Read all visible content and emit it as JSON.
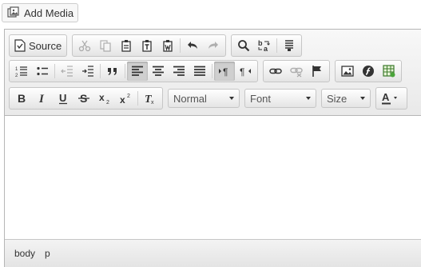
{
  "add_media": {
    "label": "Add Media",
    "icon": "media-library-icon"
  },
  "editor": {
    "toolbar": {
      "source_label": "Source",
      "icons": {
        "source": "source-icon",
        "cut": "cut-icon",
        "copy": "copy-icon",
        "paste": "paste-icon",
        "paste_text": "paste-text-icon",
        "paste_word": "paste-word-icon",
        "undo": "undo-icon",
        "redo": "redo-icon",
        "find": "find-icon",
        "replace": "replace-icon",
        "select_all": "select-all-icon",
        "numbered_list": "numbered-list-icon",
        "bulleted_list": "bulleted-list-icon",
        "decrease_indent": "decrease-indent-icon",
        "increase_indent": "increase-indent-icon",
        "blockquote": "blockquote-icon",
        "align_left": "align-left-icon",
        "align_center": "align-center-icon",
        "align_right": "align-right-icon",
        "justify": "justify-icon",
        "ltr": "text-direction-ltr-icon",
        "rtl": "text-direction-rtl-icon",
        "link": "link-icon",
        "unlink": "unlink-icon",
        "anchor": "anchor-flag-icon",
        "image": "image-icon",
        "flash": "flash-icon",
        "table": "table-icon",
        "bold": "bold-icon",
        "italic": "italic-icon",
        "underline": "underline-icon",
        "strike": "strikethrough-icon",
        "subscript": "subscript-icon",
        "superscript": "superscript-icon",
        "remove_format": "remove-format-icon",
        "text_color": "text-color-icon"
      },
      "format": {
        "selected": "Normal"
      },
      "font": {
        "selected": "Font"
      },
      "size": {
        "selected": "Size"
      },
      "active": {
        "align_left": true,
        "ltr": true
      }
    },
    "content": "",
    "statusbar": {
      "path": [
        "body",
        "p"
      ]
    }
  },
  "colors": {
    "toolbar_bg": "#efefef",
    "border": "#b6b6b6",
    "text": "#333333",
    "active_button": "#cfcfcf"
  }
}
